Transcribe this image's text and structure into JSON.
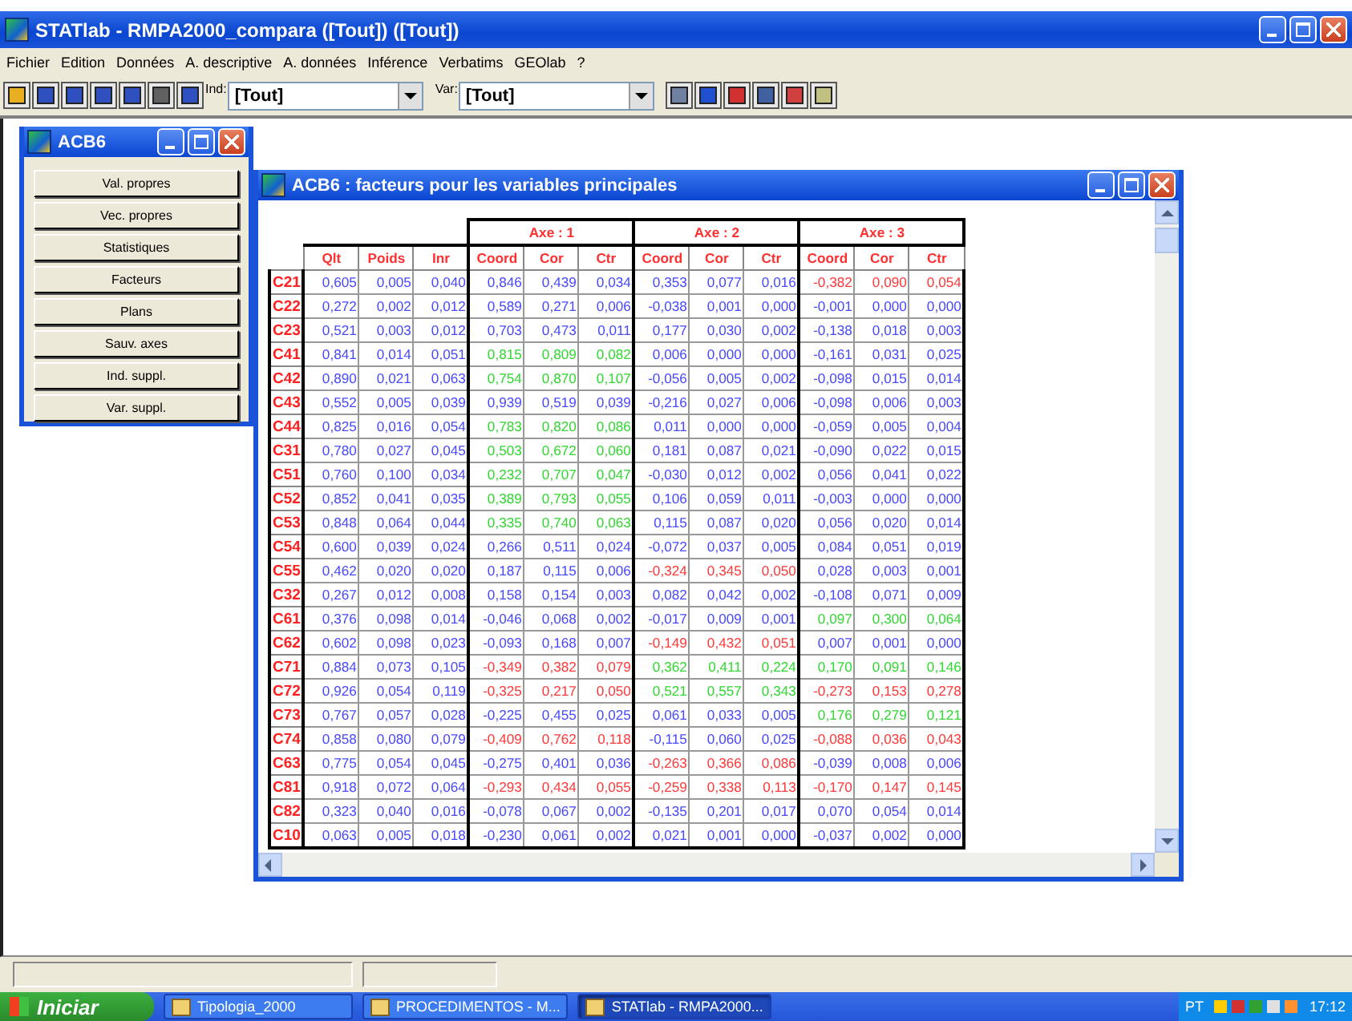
{
  "window": {
    "title": "STATlab - RMPA2000_compara ([Tout]) ([Tout])"
  },
  "menu": [
    "Fichier",
    "Edition",
    "Données",
    "A. descriptive",
    "A. données",
    "Inférence",
    "Verbatims",
    "GEOlab",
    "?"
  ],
  "toolbar": {
    "ind_label": "Ind:",
    "ind_value": "[Tout]",
    "var_label": "Var:",
    "var_value": "[Tout]"
  },
  "side_window": {
    "title": "ACB6",
    "buttons": [
      "Val. propres",
      "Vec. propres",
      "Statistiques",
      "Facteurs",
      "Plans",
      "Sauv. axes",
      "Ind. suppl.",
      "Var. suppl."
    ]
  },
  "table_window": {
    "title": "ACB6 : facteurs pour les variables principales",
    "table": {
      "base_columns": [
        "Qlt",
        "Poids",
        "Inr"
      ],
      "axes": [
        {
          "label": "Axe : 1",
          "columns": [
            "Coord",
            "Cor",
            "Ctr"
          ]
        },
        {
          "label": "Axe : 2",
          "columns": [
            "Coord",
            "Cor",
            "Ctr"
          ]
        },
        {
          "label": "Axe : 3",
          "columns": [
            "Coord",
            "Cor",
            "Ctr"
          ]
        }
      ],
      "rows": [
        {
          "label": "C21",
          "values": [
            "0,605",
            "0,005",
            "0,040"
          ],
          "axes": [
            {
              "color": "#4848ff",
              "values": [
                "0,846",
                "0,439",
                "0,034"
              ]
            },
            {
              "color": "#4848ff",
              "values": [
                "0,353",
                "0,077",
                "0,016"
              ]
            },
            {
              "color": "#ff3838",
              "values": [
                "-0,382",
                "0,090",
                "0,054"
              ]
            }
          ]
        },
        {
          "label": "C22",
          "values": [
            "0,272",
            "0,002",
            "0,012"
          ],
          "axes": [
            {
              "color": "#4848ff",
              "values": [
                "0,589",
                "0,271",
                "0,006"
              ]
            },
            {
              "color": "#4848ff",
              "values": [
                "-0,038",
                "0,001",
                "0,000"
              ]
            },
            {
              "color": "#4848ff",
              "values": [
                "-0,001",
                "0,000",
                "0,000"
              ]
            }
          ]
        },
        {
          "label": "C23",
          "values": [
            "0,521",
            "0,003",
            "0,012"
          ],
          "axes": [
            {
              "color": "#4848ff",
              "values": [
                "0,703",
                "0,473",
                "0,011"
              ]
            },
            {
              "color": "#4848ff",
              "values": [
                "0,177",
                "0,030",
                "0,002"
              ]
            },
            {
              "color": "#4848ff",
              "values": [
                "-0,138",
                "0,018",
                "0,003"
              ]
            }
          ]
        },
        {
          "label": "C41",
          "values": [
            "0,841",
            "0,014",
            "0,051"
          ],
          "axes": [
            {
              "color": "#30d830",
              "values": [
                "0,815",
                "0,809",
                "0,082"
              ]
            },
            {
              "color": "#4848ff",
              "values": [
                "0,006",
                "0,000",
                "0,000"
              ]
            },
            {
              "color": "#4848ff",
              "values": [
                "-0,161",
                "0,031",
                "0,025"
              ]
            }
          ]
        },
        {
          "label": "C42",
          "values": [
            "0,890",
            "0,021",
            "0,063"
          ],
          "axes": [
            {
              "color": "#30d830",
              "values": [
                "0,754",
                "0,870",
                "0,107"
              ]
            },
            {
              "color": "#4848ff",
              "values": [
                "-0,056",
                "0,005",
                "0,002"
              ]
            },
            {
              "color": "#4848ff",
              "values": [
                "-0,098",
                "0,015",
                "0,014"
              ]
            }
          ]
        },
        {
          "label": "C43",
          "values": [
            "0,552",
            "0,005",
            "0,039"
          ],
          "axes": [
            {
              "color": "#4848ff",
              "values": [
                "0,939",
                "0,519",
                "0,039"
              ]
            },
            {
              "color": "#4848ff",
              "values": [
                "-0,216",
                "0,027",
                "0,006"
              ]
            },
            {
              "color": "#4848ff",
              "values": [
                "-0,098",
                "0,006",
                "0,003"
              ]
            }
          ]
        },
        {
          "label": "C44",
          "values": [
            "0,825",
            "0,016",
            "0,054"
          ],
          "axes": [
            {
              "color": "#30d830",
              "values": [
                "0,783",
                "0,820",
                "0,086"
              ]
            },
            {
              "color": "#4848ff",
              "values": [
                "0,011",
                "0,000",
                "0,000"
              ]
            },
            {
              "color": "#4848ff",
              "values": [
                "-0,059",
                "0,005",
                "0,004"
              ]
            }
          ]
        },
        {
          "label": "C31",
          "values": [
            "0,780",
            "0,027",
            "0,045"
          ],
          "axes": [
            {
              "color": "#30d830",
              "values": [
                "0,503",
                "0,672",
                "0,060"
              ]
            },
            {
              "color": "#4848ff",
              "values": [
                "0,181",
                "0,087",
                "0,021"
              ]
            },
            {
              "color": "#4848ff",
              "values": [
                "-0,090",
                "0,022",
                "0,015"
              ]
            }
          ]
        },
        {
          "label": "C51",
          "values": [
            "0,760",
            "0,100",
            "0,034"
          ],
          "axes": [
            {
              "color": "#30d830",
              "values": [
                "0,232",
                "0,707",
                "0,047"
              ]
            },
            {
              "color": "#4848ff",
              "values": [
                "-0,030",
                "0,012",
                "0,002"
              ]
            },
            {
              "color": "#4848ff",
              "values": [
                "0,056",
                "0,041",
                "0,022"
              ]
            }
          ]
        },
        {
          "label": "C52",
          "values": [
            "0,852",
            "0,041",
            "0,035"
          ],
          "axes": [
            {
              "color": "#30d830",
              "values": [
                "0,389",
                "0,793",
                "0,055"
              ]
            },
            {
              "color": "#4848ff",
              "values": [
                "0,106",
                "0,059",
                "0,011"
              ]
            },
            {
              "color": "#4848ff",
              "values": [
                "-0,003",
                "0,000",
                "0,000"
              ]
            }
          ]
        },
        {
          "label": "C53",
          "values": [
            "0,848",
            "0,064",
            "0,044"
          ],
          "axes": [
            {
              "color": "#30d830",
              "values": [
                "0,335",
                "0,740",
                "0,063"
              ]
            },
            {
              "color": "#4848ff",
              "values": [
                "0,115",
                "0,087",
                "0,020"
              ]
            },
            {
              "color": "#4848ff",
              "values": [
                "0,056",
                "0,020",
                "0,014"
              ]
            }
          ]
        },
        {
          "label": "C54",
          "values": [
            "0,600",
            "0,039",
            "0,024"
          ],
          "axes": [
            {
              "color": "#4848ff",
              "values": [
                "0,266",
                "0,511",
                "0,024"
              ]
            },
            {
              "color": "#4848ff",
              "values": [
                "-0,072",
                "0,037",
                "0,005"
              ]
            },
            {
              "color": "#4848ff",
              "values": [
                "0,084",
                "0,051",
                "0,019"
              ]
            }
          ]
        },
        {
          "label": "C55",
          "values": [
            "0,462",
            "0,020",
            "0,020"
          ],
          "axes": [
            {
              "color": "#4848ff",
              "values": [
                "0,187",
                "0,115",
                "0,006"
              ]
            },
            {
              "color": "#ff3838",
              "values": [
                "-0,324",
                "0,345",
                "0,050"
              ]
            },
            {
              "color": "#4848ff",
              "values": [
                "0,028",
                "0,003",
                "0,001"
              ]
            }
          ]
        },
        {
          "label": "C32",
          "values": [
            "0,267",
            "0,012",
            "0,008"
          ],
          "axes": [
            {
              "color": "#4848ff",
              "values": [
                "0,158",
                "0,154",
                "0,003"
              ]
            },
            {
              "color": "#4848ff",
              "values": [
                "0,082",
                "0,042",
                "0,002"
              ]
            },
            {
              "color": "#4848ff",
              "values": [
                "-0,108",
                "0,071",
                "0,009"
              ]
            }
          ]
        },
        {
          "label": "C61",
          "values": [
            "0,376",
            "0,098",
            "0,014"
          ],
          "axes": [
            {
              "color": "#4848ff",
              "values": [
                "-0,046",
                "0,068",
                "0,002"
              ]
            },
            {
              "color": "#4848ff",
              "values": [
                "-0,017",
                "0,009",
                "0,001"
              ]
            },
            {
              "color": "#30d830",
              "values": [
                "0,097",
                "0,300",
                "0,064"
              ]
            }
          ]
        },
        {
          "label": "C62",
          "values": [
            "0,602",
            "0,098",
            "0,023"
          ],
          "axes": [
            {
              "color": "#4848ff",
              "values": [
                "-0,093",
                "0,168",
                "0,007"
              ]
            },
            {
              "color": "#ff3838",
              "values": [
                "-0,149",
                "0,432",
                "0,051"
              ]
            },
            {
              "color": "#4848ff",
              "values": [
                "0,007",
                "0,001",
                "0,000"
              ]
            }
          ]
        },
        {
          "label": "C71",
          "values": [
            "0,884",
            "0,073",
            "0,105"
          ],
          "axes": [
            {
              "color": "#ff3838",
              "values": [
                "-0,349",
                "0,382",
                "0,079"
              ]
            },
            {
              "color": "#30d830",
              "values": [
                "0,362",
                "0,411",
                "0,224"
              ]
            },
            {
              "color": "#30d830",
              "values": [
                "0,170",
                "0,091",
                "0,146"
              ]
            }
          ]
        },
        {
          "label": "C72",
          "values": [
            "0,926",
            "0,054",
            "0,119"
          ],
          "axes": [
            {
              "color": "#ff3838",
              "values": [
                "-0,325",
                "0,217",
                "0,050"
              ]
            },
            {
              "color": "#30d830",
              "values": [
                "0,521",
                "0,557",
                "0,343"
              ]
            },
            {
              "color": "#ff3838",
              "values": [
                "-0,273",
                "0,153",
                "0,278"
              ]
            }
          ]
        },
        {
          "label": "C73",
          "values": [
            "0,767",
            "0,057",
            "0,028"
          ],
          "axes": [
            {
              "color": "#4848ff",
              "values": [
                "-0,225",
                "0,455",
                "0,025"
              ]
            },
            {
              "color": "#4848ff",
              "values": [
                "0,061",
                "0,033",
                "0,005"
              ]
            },
            {
              "color": "#30d830",
              "values": [
                "0,176",
                "0,279",
                "0,121"
              ]
            }
          ]
        },
        {
          "label": "C74",
          "values": [
            "0,858",
            "0,080",
            "0,079"
          ],
          "axes": [
            {
              "color": "#ff3838",
              "values": [
                "-0,409",
                "0,762",
                "0,118"
              ]
            },
            {
              "color": "#4848ff",
              "values": [
                "-0,115",
                "0,060",
                "0,025"
              ]
            },
            {
              "color": "#ff3838",
              "values": [
                "-0,088",
                "0,036",
                "0,043"
              ]
            }
          ]
        },
        {
          "label": "C63",
          "values": [
            "0,775",
            "0,054",
            "0,045"
          ],
          "axes": [
            {
              "color": "#4848ff",
              "values": [
                "-0,275",
                "0,401",
                "0,036"
              ]
            },
            {
              "color": "#ff3838",
              "values": [
                "-0,263",
                "0,366",
                "0,086"
              ]
            },
            {
              "color": "#4848ff",
              "values": [
                "-0,039",
                "0,008",
                "0,006"
              ]
            }
          ]
        },
        {
          "label": "C81",
          "values": [
            "0,918",
            "0,072",
            "0,064"
          ],
          "axes": [
            {
              "color": "#ff3838",
              "values": [
                "-0,293",
                "0,434",
                "0,055"
              ]
            },
            {
              "color": "#ff3838",
              "values": [
                "-0,259",
                "0,338",
                "0,113"
              ]
            },
            {
              "color": "#ff3838",
              "values": [
                "-0,170",
                "0,147",
                "0,145"
              ]
            }
          ]
        },
        {
          "label": "C82",
          "values": [
            "0,323",
            "0,040",
            "0,016"
          ],
          "axes": [
            {
              "color": "#4848ff",
              "values": [
                "-0,078",
                "0,067",
                "0,002"
              ]
            },
            {
              "color": "#4848ff",
              "values": [
                "-0,135",
                "0,201",
                "0,017"
              ]
            },
            {
              "color": "#4848ff",
              "values": [
                "0,070",
                "0,054",
                "0,014"
              ]
            }
          ]
        },
        {
          "label": "C10",
          "values": [
            "0,063",
            "0,005",
            "0,018"
          ],
          "axes": [
            {
              "color": "#4848ff",
              "values": [
                "-0,230",
                "0,061",
                "0,002"
              ]
            },
            {
              "color": "#4848ff",
              "values": [
                "0,021",
                "0,001",
                "0,000"
              ]
            },
            {
              "color": "#4848ff",
              "values": [
                "-0,037",
                "0,002",
                "0,000"
              ]
            }
          ]
        }
      ]
    }
  },
  "taskbar": {
    "start": "Iniciar",
    "tasks": [
      {
        "label": "Tipologia_2000",
        "selected": false
      },
      {
        "label": "PROCEDIMENTOS - M...",
        "selected": false
      },
      {
        "label": "STATlab - RMPA2000...",
        "selected": true
      }
    ],
    "language": "PT",
    "clock": "17:12"
  }
}
